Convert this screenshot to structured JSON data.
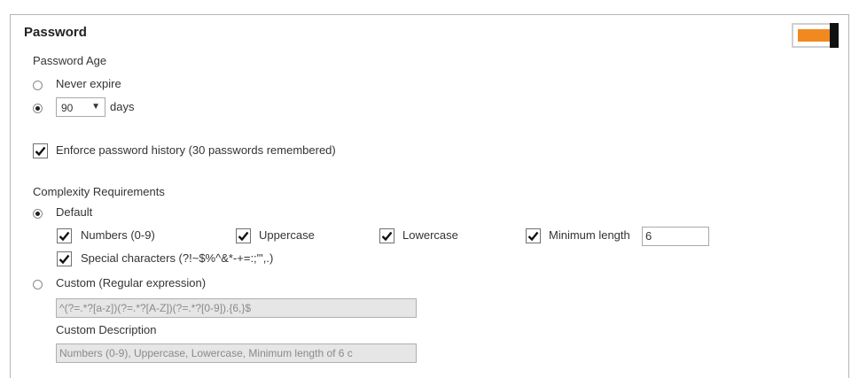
{
  "section": {
    "title": "Password",
    "toggle_state": "on",
    "accent_color": "#f2891f"
  },
  "password_age": {
    "label": "Password Age",
    "never_expire_label": "Never expire",
    "selected": "days",
    "days_value": "90",
    "days_label": "days"
  },
  "history": {
    "checked": true,
    "label": "Enforce password history (30 passwords remembered)"
  },
  "complexity": {
    "label": "Complexity Requirements",
    "selected": "default",
    "default_label": "Default",
    "numbers_label": "Numbers (0-9)",
    "uppercase_label": "Uppercase",
    "lowercase_label": "Lowercase",
    "min_length_label": "Minimum length",
    "min_length_value": "6",
    "special_label": "Special characters (?!~$%^&*-+=:;\"',.)",
    "custom_label": "Custom (Regular expression)",
    "custom_regex_value": "^(?=.*?[a-z])(?=.*?[A-Z])(?=.*?[0-9]).{6,}$",
    "custom_description_label": "Custom Description",
    "custom_description_value": "Numbers (0-9), Uppercase, Lowercase, Minimum length of 6 c"
  }
}
